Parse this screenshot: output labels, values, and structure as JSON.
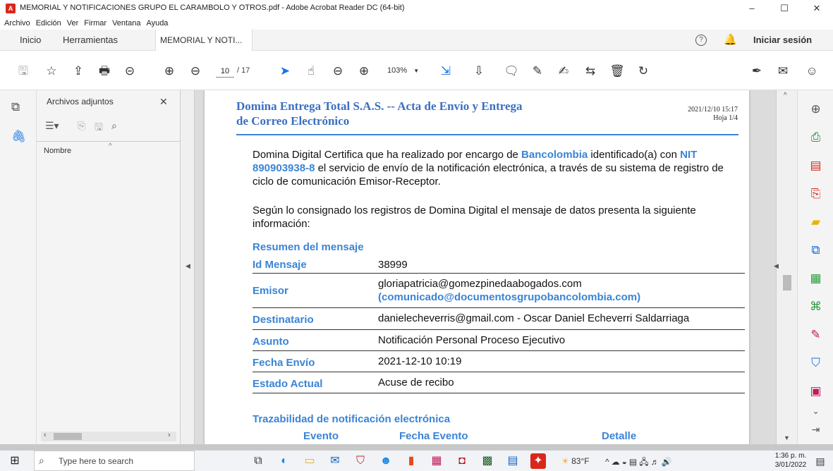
{
  "window": {
    "title": "MEMORIAL Y NOTIFICACIONES GRUPO EL CARAMBOLO Y OTROS.pdf - Adobe Acrobat Reader DC (64-bit)",
    "minimize": "–",
    "maximize": "☐",
    "close": "✕"
  },
  "menu": [
    "Archivo",
    "Edición",
    "Ver",
    "Firmar",
    "Ventana",
    "Ayuda"
  ],
  "tabs": {
    "home": "Inicio",
    "tools": "Herramientas",
    "doc": "MEMORIAL Y NOTI...",
    "doc_close": "×"
  },
  "account": {
    "help": "?",
    "signin": "Iniciar sesión"
  },
  "toolbar": {
    "page_current": "10",
    "page_total": "/ 17",
    "zoom": "103%"
  },
  "panel": {
    "title": "Archivos adjuntos",
    "close": "✕",
    "col_name": "Nombre"
  },
  "document": {
    "header_title": "Domina Entrega Total S.A.S. -- Acta de Envío y Entrega de Correo Electrónico",
    "header_title_l1": "Domina Entrega Total S.A.S. -- Acta de Envío y Entrega",
    "header_title_l2": "de Correo Electrónico",
    "header_date": "2021/12/10 15:17",
    "header_sheet": "Hoja 1/4",
    "p1_a": "Domina Digital Certifica que ha realizado por encargo de ",
    "p1_b": "Bancolombia",
    "p1_c": " identificado(a) con ",
    "p1_d": "NIT 890903938-8",
    "p1_e": " el servicio de envío de la notificación electrónica, a través de su sistema de registro de ciclo de comunicación Emisor-Receptor.",
    "p2": "Según lo consignado los registros de Domina Digital el mensaje de datos presenta la siguiente información:",
    "summary_title": "Resumen del mensaje",
    "rows": [
      {
        "k": "Id Mensaje",
        "v": "38999"
      },
      {
        "k": "Emisor",
        "v": "gloriapatricia@gomezpinedaabogados.com",
        "v2": "(comunicado@documentosgrupobancolombia.com)"
      },
      {
        "k": "Destinatario",
        "v": "danielecheverris@gmail.com - Oscar Daniel Echeverri Saldarriaga"
      },
      {
        "k": "Asunto",
        "v": "Notificación Personal Proceso Ejecutivo"
      },
      {
        "k": "Fecha Envío",
        "v": "2021-12-10 10:19"
      },
      {
        "k": "Estado Actual",
        "v": "Acuse de recibo"
      }
    ],
    "trace_title": "Trazabilidad de notificación electrónica",
    "trace_cols": [
      "Evento",
      "Fecha Evento",
      "Detalle"
    ]
  },
  "taskbar": {
    "search_placeholder": "Type here to search",
    "weather": "83°F",
    "time": "1:36 p. m.",
    "date": "3/01/2022"
  },
  "colors": {
    "accent": "#1473e6",
    "doc_blue": "#3a84d6",
    "acrobat_red": "#d9281b"
  }
}
